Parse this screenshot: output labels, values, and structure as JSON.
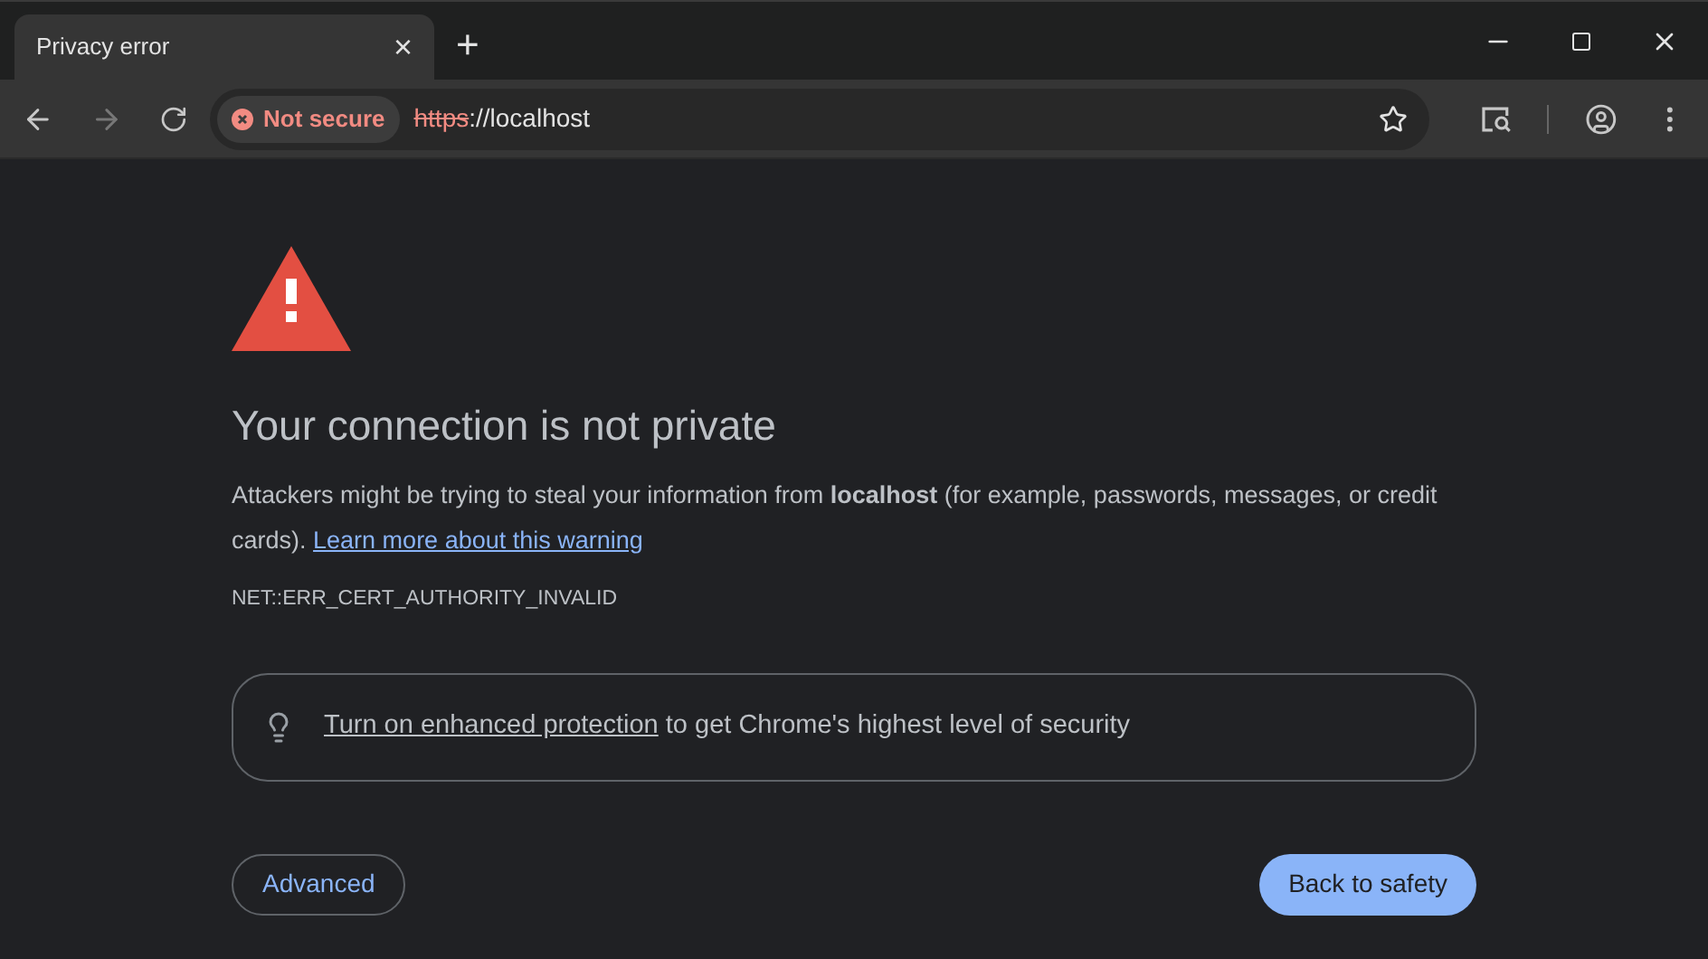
{
  "tab": {
    "title": "Privacy error",
    "close": "×",
    "new_tab": "+"
  },
  "address_bar": {
    "security_chip": "Not secure",
    "scheme": "https",
    "rest": "://localhost"
  },
  "page": {
    "heading": "Your connection is not private",
    "body": "Attackers might be trying to steal your information from **localhost** (for example, passwords, messages, or credit cards).",
    "learn_more": "Learn more about this warning",
    "error_code": "NET::ERR_CERT_AUTHORITY_INVALID",
    "protection_link": "Turn on enhanced protection",
    "protection_text": "to get Chrome's highest level of security",
    "buttons": [
      "Advanced",
      "Back to safety"
    ]
  }
}
